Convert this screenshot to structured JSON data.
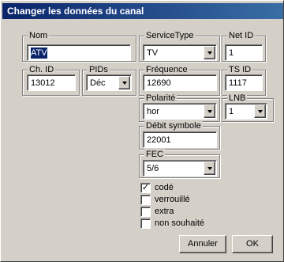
{
  "window": {
    "title": "Changer les données du canal"
  },
  "nom": {
    "label": "Nom",
    "value": "ATV"
  },
  "service_type": {
    "label": "ServiceType",
    "value": "TV"
  },
  "net_id": {
    "label": "Net ID",
    "value": "1"
  },
  "ch_id": {
    "label": "Ch. ID",
    "value": "13012"
  },
  "pids": {
    "label": "PIDs",
    "value": "Déc"
  },
  "frequence": {
    "label": "Fréquence",
    "value": "12690"
  },
  "ts_id": {
    "label": "TS ID",
    "value": "1117"
  },
  "polarite": {
    "label": "Polarité",
    "value": "hor"
  },
  "lnb": {
    "label": "LNB",
    "value": "1"
  },
  "debit_symbole": {
    "label": "Débit symbole",
    "value": "22001"
  },
  "fec": {
    "label": "FEC",
    "value": "5/6"
  },
  "checkboxes": [
    {
      "label": "codé",
      "checked": true,
      "mark": "✓"
    },
    {
      "label": "verrouillé",
      "checked": false,
      "mark": ""
    },
    {
      "label": "extra",
      "checked": false,
      "mark": ""
    },
    {
      "label": "non souhaité",
      "checked": false,
      "mark": ""
    }
  ],
  "buttons": {
    "cancel": "Annuler",
    "ok": "OK"
  }
}
